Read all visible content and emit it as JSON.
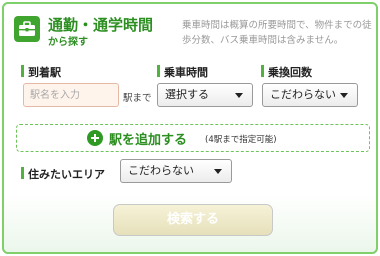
{
  "header": {
    "icon": "briefcase-icon",
    "title": "通勤・通学時間",
    "subtitle": "から探す",
    "note": "乗車時間は概算の所要時間で、物件までの徒歩分数、バス乗車時間は含みません。"
  },
  "arrival_station": {
    "label": "到着駅",
    "placeholder": "駅名を入力",
    "value": "",
    "suffix": "駅まで"
  },
  "ride_time": {
    "label": "乗車時間",
    "selected": "選択する"
  },
  "transfers": {
    "label": "乗換回数",
    "selected": "こだわらない"
  },
  "add_station": {
    "icon": "plus-circle-icon",
    "label": "駅を追加する",
    "note": "(4駅まで指定可能)"
  },
  "residence_area": {
    "label": "住みたいエリア",
    "selected": "こだわらない"
  },
  "search_button": {
    "label": "検索する",
    "state": "disabled"
  },
  "colors": {
    "accent_green": "#2d8f22",
    "border_green": "#7fcf6a",
    "input_bg": "#fff4ec",
    "button_bg": "#f0ebcb"
  }
}
